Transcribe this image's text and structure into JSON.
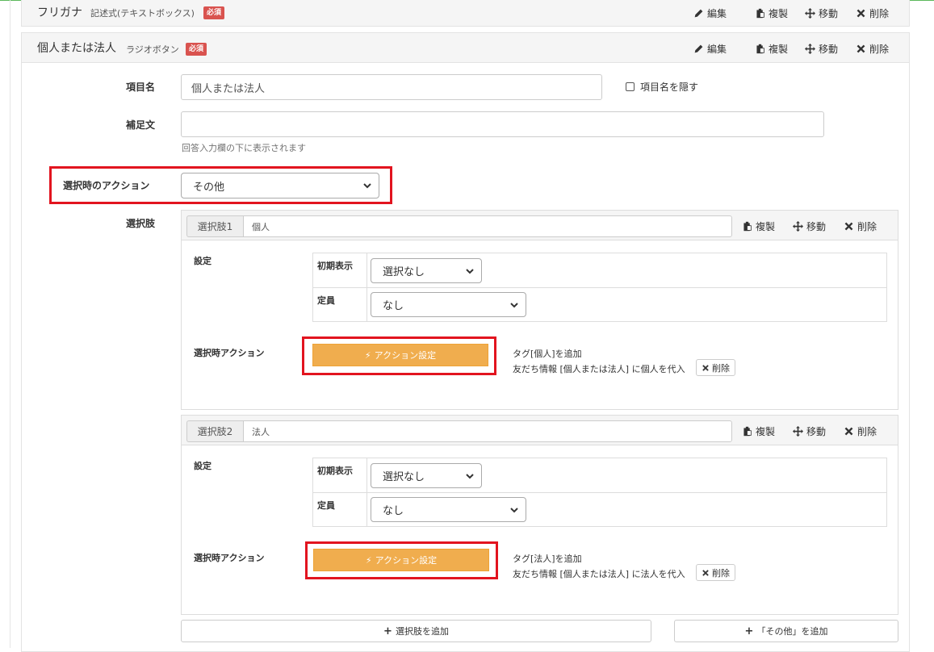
{
  "field_furigana": {
    "title": "フリガナ",
    "type_label": "記述式(テキストボックス)",
    "badge": "必須",
    "actions": {
      "edit": "編集",
      "copy": "複製",
      "move": "移動",
      "delete": "削除"
    }
  },
  "field_individual": {
    "title": "個人または法人",
    "type_label": "ラジオボタン",
    "badge": "必須",
    "actions": {
      "edit": "編集",
      "copy": "複製",
      "move": "移動",
      "delete": "削除"
    },
    "item_name": {
      "label": "項目名",
      "value": "個人または法人"
    },
    "hide_item_name": "項目名を隠す",
    "supplement": {
      "label": "補足文",
      "value": "",
      "help": "回答入力欄の下に表示されます"
    },
    "selection_action": {
      "label": "選択時のアクション",
      "value": "その他"
    },
    "choices_label": "選択肢",
    "choices": [
      {
        "prefix": "選択肢1",
        "value": "個人",
        "actions": {
          "copy": "複製",
          "move": "移動",
          "delete": "削除"
        },
        "settings_label": "設定",
        "initial_display": {
          "label": "初期表示",
          "value": "選択なし"
        },
        "capacity": {
          "label": "定員",
          "value": "なし"
        },
        "action_label": "選択時アクション",
        "action_button": "アクション設定",
        "notes": [
          "タグ[個人]を追加",
          "友だち情報 [個人または法人] に個人を代入"
        ],
        "note_delete": "削除"
      },
      {
        "prefix": "選択肢2",
        "value": "法人",
        "actions": {
          "copy": "複製",
          "move": "移動",
          "delete": "削除"
        },
        "settings_label": "設定",
        "initial_display": {
          "label": "初期表示",
          "value": "選択なし"
        },
        "capacity": {
          "label": "定員",
          "value": "なし"
        },
        "action_label": "選択時アクション",
        "action_button": "アクション設定",
        "notes": [
          "タグ[法人]を追加",
          "友だち情報 [個人または法人] に法人を代入"
        ],
        "note_delete": "削除"
      }
    ],
    "add_choice": "選択肢を追加",
    "add_other": "「その他」を追加"
  },
  "colors": {
    "badge": "#d9534f",
    "highlight": "#e2141f",
    "action_button": "#f0ad4e"
  }
}
